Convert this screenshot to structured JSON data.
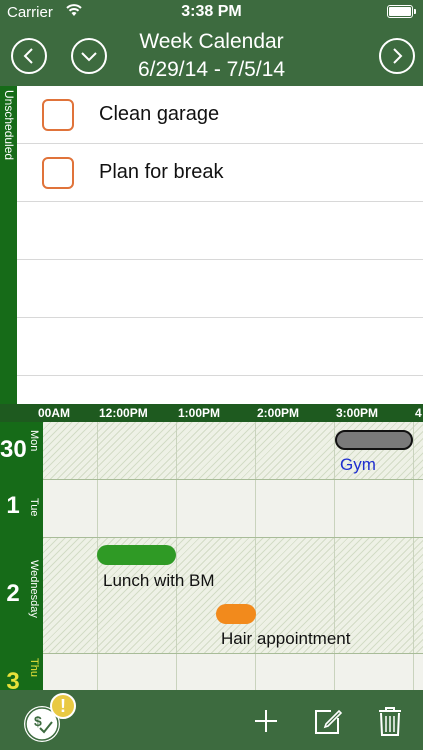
{
  "status_bar": {
    "carrier": "Carrier",
    "time": "3:38 PM"
  },
  "header": {
    "title": "Week Calendar",
    "date_range": "6/29/14 - 7/5/14"
  },
  "unscheduled": {
    "label": "Unscheduled",
    "tasks": [
      {
        "text": "Clean garage",
        "done": false
      },
      {
        "text": "Plan for break",
        "done": false
      }
    ]
  },
  "timeline": {
    "hours": [
      "00AM",
      "12:00PM",
      "1:00PM",
      "2:00PM",
      "3:00PM",
      "4"
    ]
  },
  "days": [
    {
      "num": "30",
      "name": "Mon",
      "events": [
        {
          "title": "Gym",
          "color": "#7a7a7a",
          "label_color": "#1f2fd0"
        }
      ]
    },
    {
      "num": "1",
      "name": "Tue",
      "events": []
    },
    {
      "num": "2",
      "name": "Wednesday",
      "events": [
        {
          "title": "Lunch with BM",
          "color": "#2f9a25",
          "label_color": "#111111"
        },
        {
          "title": "Hair appointment",
          "color": "#f28a1c",
          "label_color": "#111111"
        }
      ]
    },
    {
      "num": "3",
      "name": "Thu",
      "num_color": "#e8e23a",
      "events": []
    }
  ],
  "toolbar": {
    "warning_badge": "!"
  },
  "colors": {
    "header": "#3d6b3f",
    "sidebar": "#166b18",
    "checkbox": "#e0733a"
  }
}
